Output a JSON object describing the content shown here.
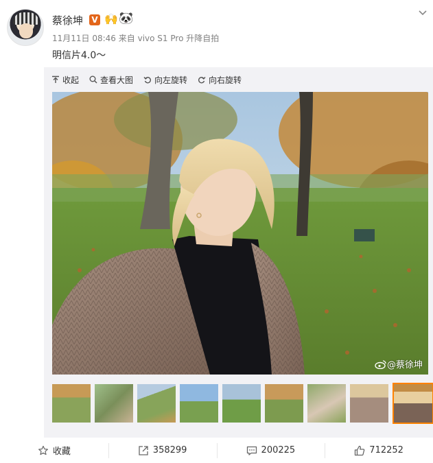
{
  "post": {
    "author": "蔡徐坤",
    "verified_badge": "V",
    "emoji_1": "🙌",
    "emoji_2": "🐼",
    "date": "11月11日 08:46",
    "source_prefix": "来自",
    "source": "vivo S1 Pro 升降自拍",
    "text": "明信片4.0～"
  },
  "toolbar": {
    "collapse": "收起",
    "view_large": "查看大图",
    "rotate_left": "向左旋转",
    "rotate_right": "向右旋转"
  },
  "watermark": "@蔡徐坤",
  "thumbnails": {
    "count": 9,
    "selected_index": 9
  },
  "footer": {
    "favorite": "收藏",
    "repost_count": "358299",
    "comment_count": "200225",
    "like_count": "712252"
  },
  "colors": {
    "accent": "#ff8200",
    "vbadge": "#e3661b",
    "media_bg": "#f2f2f5",
    "meta_text": "#808080"
  },
  "icons": [
    "chevron-down-icon",
    "collapse-icon",
    "search-icon",
    "rotate-left-icon",
    "rotate-right-icon",
    "weibo-logo-icon",
    "star-icon",
    "repost-icon",
    "comment-icon",
    "like-icon"
  ]
}
